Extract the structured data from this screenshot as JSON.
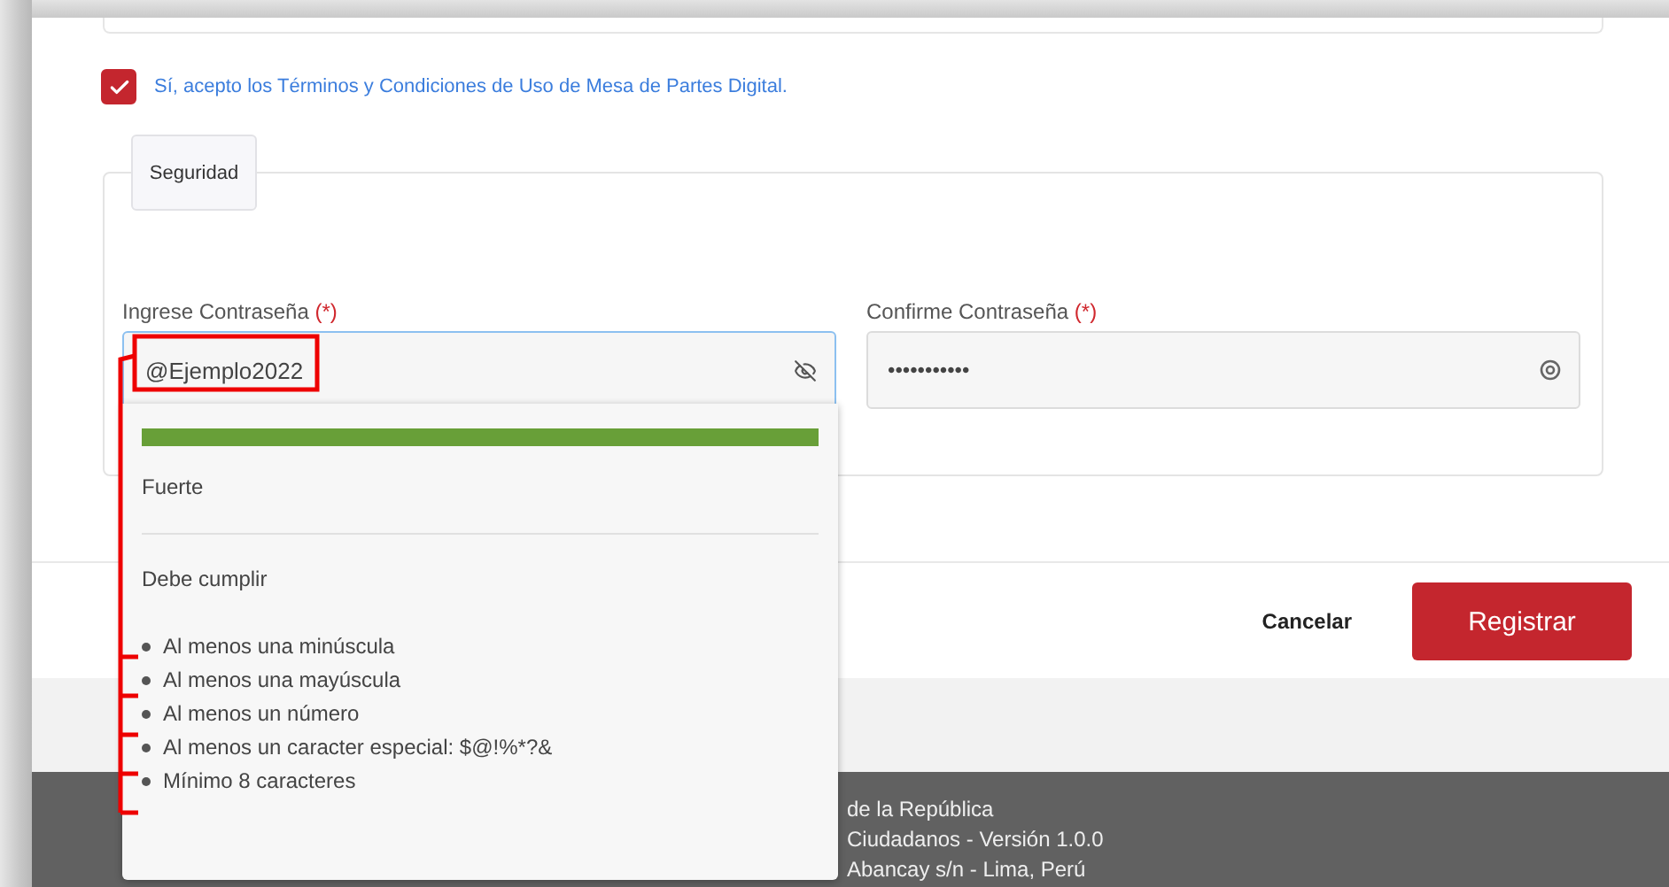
{
  "terms": {
    "checked": true,
    "text": "Sí, acepto los Términos y Condiciones de Uso de Mesa de Partes Digital."
  },
  "security": {
    "legend": "Seguridad",
    "fields": [
      {
        "label": "Ingrese Contraseña",
        "required": "(*)",
        "value": "@Ejemplo2022",
        "kind": "visible",
        "focused": true
      },
      {
        "label": "Confirme Contraseña",
        "required": "(*)",
        "value": "•••••••••••",
        "kind": "masked",
        "focused": false
      }
    ]
  },
  "strength_popup": {
    "level": 1,
    "strength": "Fuerte",
    "rules_title": "Debe cumplir",
    "rules": [
      "Al menos una minúscula",
      "Al menos una mayúscula",
      "Al menos un número",
      "Al menos un caracter especial: $@!%*?&",
      "Mínimo 8 caracteres"
    ]
  },
  "buttons": [
    {
      "label": "Cancelar",
      "kind": "link"
    },
    {
      "label": "Registrar",
      "kind": "primary"
    }
  ],
  "footer": [
    "de la República",
    "Ciudadanos - Versión 1.0.0",
    "Abancay s/n - Lima, Perú"
  ]
}
